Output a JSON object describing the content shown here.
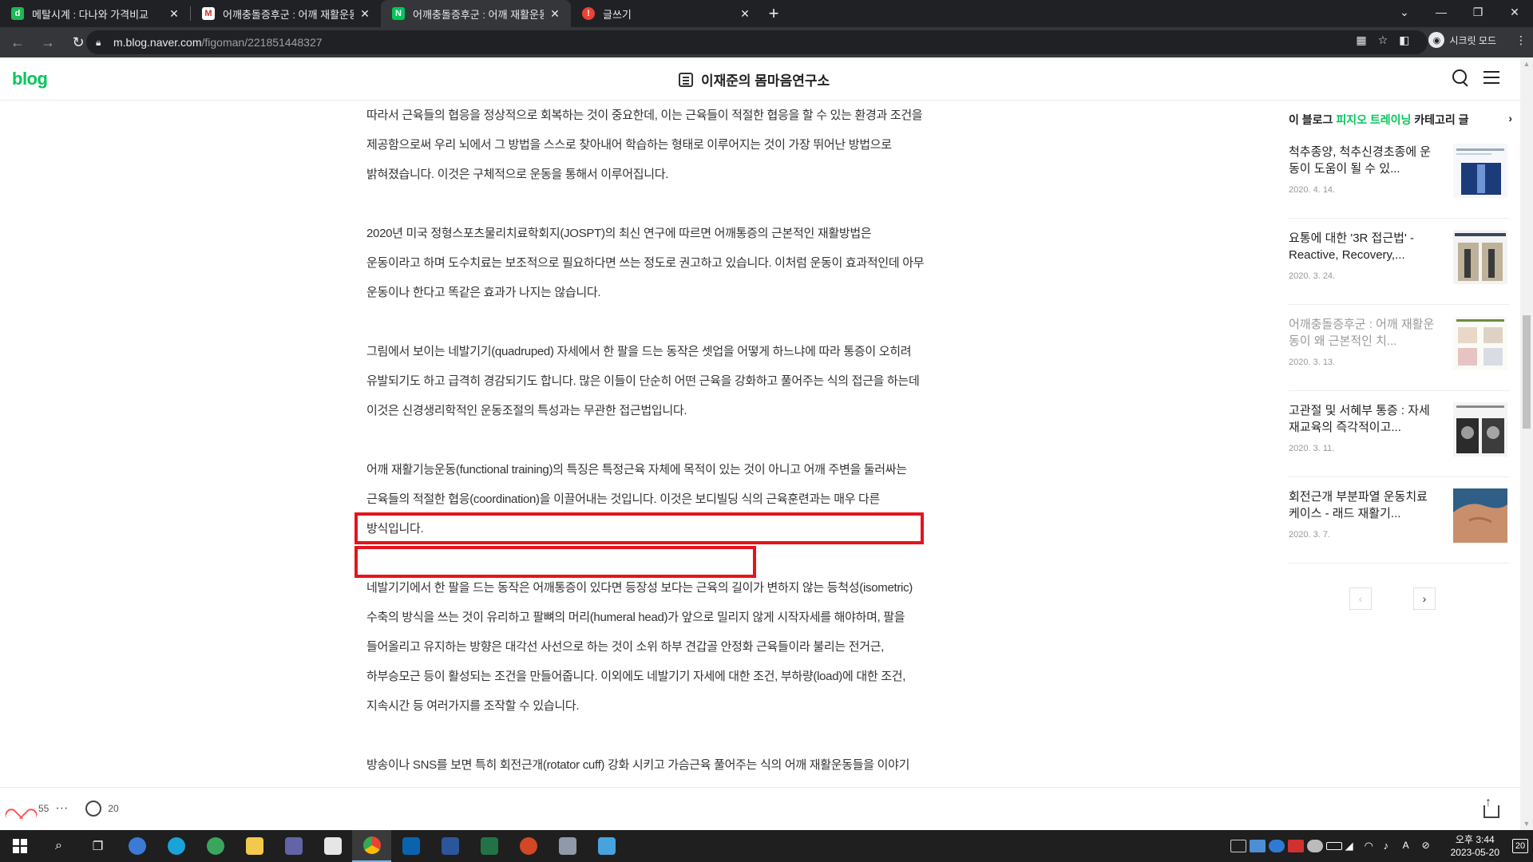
{
  "browser": {
    "tabs": [
      {
        "title": "메탈시계 : 다나와 가격비교",
        "favicon": "d",
        "color": "#1db954",
        "active": false
      },
      {
        "title": "어깨충돌증후군 : 어깨 재활운동",
        "favicon": "M",
        "color": "#d93025",
        "active": false
      },
      {
        "title": "어깨충돌증후군 : 어깨 재활운동",
        "favicon": "N",
        "color": "#03c75a",
        "active": true
      },
      {
        "title": "글쓰기",
        "favicon": "!",
        "color": "#ea4335",
        "active": false
      }
    ],
    "url_host": "m.blog.naver.com",
    "url_path": "/figoman/221851448327",
    "incognito_label": "시크릿 모드"
  },
  "header": {
    "logo": "blog",
    "blog_title": "이재준의 몸마음연구소"
  },
  "article": {
    "paragraphs": [
      "따라서 근육들의 협응을 정상적으로 회복하는 것이 중요한데, 이는 근육들이 적절한 협응을 할 수 있는 환경과 조건을 제공함으로써 우리 뇌에서 그 방법을 스스로 찾아내어 학습하는 형태로 이루어지는 것이 가장 뛰어난 방법으로 밝혀졌습니다. 이것은 구체적으로 운동을 통해서 이루어집니다.",
      "2020년 미국 정형스포츠물리치료학회지(JOSPT)의 최신 연구에 따르면 어깨통증의 근본적인 재활방법은 운동이라고 하며 도수치료는 보조적으로 필요하다면 쓰는 정도로 권고하고 있습니다. 이처럼 운동이 효과적인데 아무 운동이나 한다고 똑같은 효과가 나지는 않습니다.",
      "그림에서 보이는 네발기기(quadruped) 자세에서 한 팔을 드는 동작은 셋업을 어떻게 하느냐에 따라 통증이 오히려 유발되기도 하고 급격히 경감되기도 합니다. 많은 이들이 단순히 어떤 근육을 강화하고 풀어주는 식의 접근을 하는데 이것은 신경생리학적인 운동조절의 특성과는 무관한 접근법입니다.",
      "어깨 재활기능운동(functional training)의 특징은 특정근육 자체에 목적이 있는 것이 아니고 어깨 주변을 둘러싸는 근육들의 적절한 협응(coordination)을 이끌어내는 것입니다. 이것은 보디빌딩 식의 근육훈련과는 매우 다른 방식입니다.",
      "네발기기에서 한 팔을 드는 동작은 어깨통증이 있다면 등장성 보다는 근육의 길이가 변하지 않는 등척성(isometric) 수축의 방식을 쓰는 것이 유리하고 팔뼈의 머리(humeral head)가 앞으로 밀리지 않게 시작자세를 해야하며, 팔을 들어올리고 유지하는 방향은 대각선 사선으로 하는 것이 소위 하부 견갑골 안정화 근육들이라 불리는 전거근, 하부승모근 등이 활성되는 조건을 만들어줍니다. 이외에도 네발기기 자세에 대한 조건, 부하량(load)에 대한 조건, 지속시간 등 여러가지를 조작할 수 있습니다.",
      "방송이나 SNS를 보면 특히 회전근개(rotator cuff) 강화 시키고 가슴근육 풀어주는 식의 어깨 재활운동들을 이야기 하는데 이것은 과학적으로 매우 거리가 먼 주장들입니다. 왜냐하면 회전근개만을 선택적으로 수축"
    ]
  },
  "sidebar": {
    "heading_prefix": "이 블로그",
    "heading_category": "피지오 트레이닝",
    "heading_suffix": "카테고리 글",
    "posts": [
      {
        "title": "척추종양, 척추신경초종에 운동이 도움이 될 수 있...",
        "date": "2020. 4. 14.",
        "read": false
      },
      {
        "title": "요통에 대한 '3R 접근법' - Reactive, Recovery,...",
        "date": "2020. 3. 24.",
        "read": false
      },
      {
        "title": "어깨충돌증후군 : 어깨 재활운동이 왜 근본적인 치...",
        "date": "2020. 3. 13.",
        "read": true
      },
      {
        "title": "고관절 및 서혜부 통증 : 자세 재교육의 즉각적이고...",
        "date": "2020. 3. 11.",
        "read": false
      },
      {
        "title": "회전근개 부분파열 운동치료 케이스 - 래드 재활기...",
        "date": "2020. 3. 7.",
        "read": false
      }
    ]
  },
  "bottom_bar": {
    "likes": "55",
    "more": "···",
    "comments": "20"
  },
  "taskbar": {
    "time": "오후 3:44",
    "date": "2023-05-20",
    "notifications": "20"
  }
}
